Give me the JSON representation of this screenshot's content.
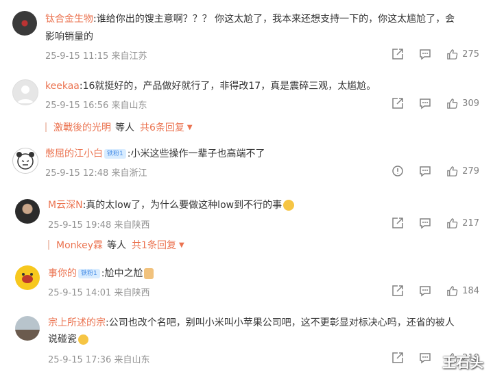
{
  "comments": [
    {
      "user": "钛合金生物",
      "text_line1": ":谁给你出的馊主意啊？？？ 你这太尬了，我本来还想支持一下的，你这太尴尬了，会",
      "text_line2": "影响销量的",
      "time": "25-9-15 11:15 来自江苏",
      "likes": "275"
    },
    {
      "user": "keekaa",
      "text_line1": ":16就挺好的，产品做好就行了，非得改17，真是震碎三观，太尴尬。",
      "time": "25-9-15 16:56 来自山东",
      "likes": "309",
      "reply_user": "激戰後的光明",
      "reply_mid": "等人",
      "reply_count": "共6条回复"
    },
    {
      "user": "憋屈的江小白",
      "badge": "铁粉1",
      "text_line1": ":小米这些操作一辈子也高端不了",
      "time": "25-9-15 12:48 来自浙江",
      "likes": "279"
    },
    {
      "user": "M云深N",
      "text_line1": ":真的太low了，为什么要做这种low到不行的事",
      "time": "25-9-15 19:48 来自陕西",
      "likes": "217",
      "reply_user": "Monkey霖",
      "reply_mid": "等人",
      "reply_count": "共1条回复"
    },
    {
      "user": "事你的",
      "badge": "铁粉1",
      "text_line1": ":尬中之尬",
      "time": "25-9-15 14:01 来自陕西",
      "likes": "184"
    },
    {
      "user": "宗上所述的宗",
      "text_line1": ":公司也改个名吧，别叫小米叫小苹果公司吧，这不更彰显对标决心吗，还省的被人",
      "text_line2": "说碰瓷",
      "time": "25-9-15 17:36 来自山东",
      "likes": "218"
    }
  ],
  "watermark": "王石头",
  "colors": {
    "username": "#eb7350",
    "meta": "#939393",
    "icon": "#808080"
  }
}
